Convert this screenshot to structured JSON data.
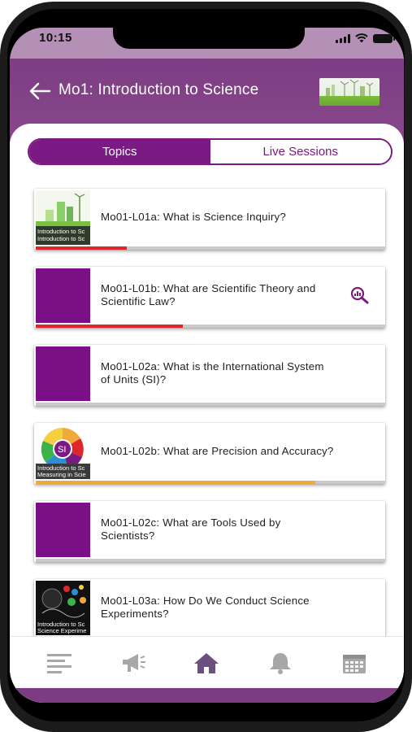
{
  "status_bar": {
    "time": "10:15"
  },
  "header": {
    "title": "Mo1: Introduction to Science",
    "back_icon": "arrow-left-icon",
    "thumbnail_icon": "wind-turbine-thumbnail"
  },
  "tabs": [
    {
      "label": "Topics",
      "active": true
    },
    {
      "label": "Live Sessions",
      "active": false
    }
  ],
  "lessons": [
    {
      "title": "Mo01-L01a: What is Science Inquiry?",
      "thumb": "intro-science-city-thumbnail",
      "progress": 0.26,
      "progress_color": "#e0262d"
    },
    {
      "title": "Mo01-L01b: What are Scientific Theory and Scientific Law?",
      "thumb": "purple-placeholder",
      "progress": 0.42,
      "progress_color": "#e0262d",
      "action_icon": "magnifier-chart-icon"
    },
    {
      "title": "Mo01-L02a: What is the International System of Units (SI)?",
      "thumb": "purple-placeholder",
      "progress": 0,
      "progress_color": "#c9c9c9"
    },
    {
      "title": "Mo01-L02b: What are Precision and Accuracy?",
      "thumb": "si-units-thumbnail",
      "progress": 0.8,
      "progress_color": "#f2a93b"
    },
    {
      "title": "Mo01-L02c: What are Tools Used by Scientists?",
      "thumb": "purple-placeholder",
      "progress": 0,
      "progress_color": "#c9c9c9"
    },
    {
      "title": "Mo01-L03a: How Do We Conduct Science Experiments?",
      "thumb": "science-experiments-thumbnail",
      "progress": 0,
      "progress_color": "#c9c9c9"
    }
  ],
  "thumbnail_text": {
    "intro": [
      "Introduction to Sc",
      "Introduction to Sc"
    ],
    "si_badge": "SI",
    "si": [
      "Introduction to Sc",
      "Measuring in Scie"
    ],
    "experiments": [
      "Introduction to Sc",
      "Science Experime"
    ]
  },
  "bottom_nav": [
    {
      "name": "menu-icon"
    },
    {
      "name": "megaphone-icon"
    },
    {
      "name": "home-icon",
      "active": true
    },
    {
      "name": "bell-icon"
    },
    {
      "name": "calendar-icon"
    }
  ],
  "colors": {
    "brand_purple": "#7b1a83",
    "header_purple": "#8b4a8e",
    "progress_red": "#e0262d",
    "progress_orange": "#f2a93b",
    "nav_icon_gray": "#a7a7a7",
    "nav_active": "#6b4f7e"
  }
}
